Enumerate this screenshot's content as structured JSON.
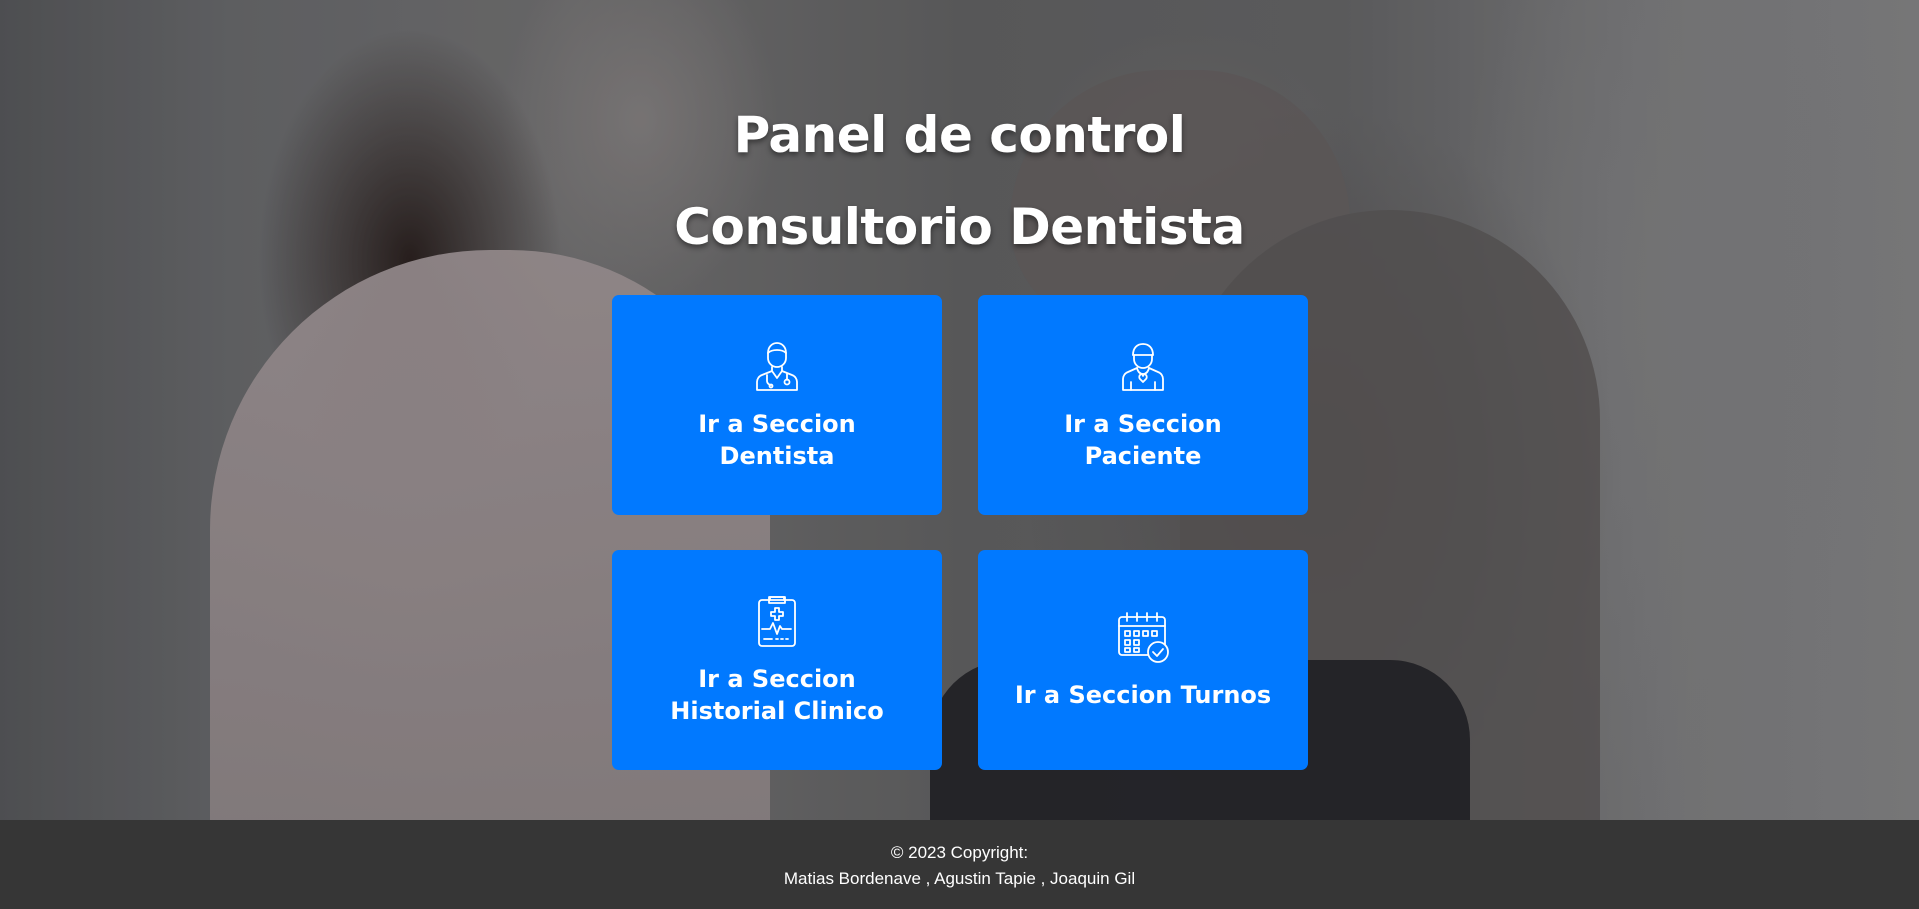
{
  "header": {
    "title_line1": "Panel de control",
    "title_line2": "Consultorio Dentista"
  },
  "cards": [
    {
      "label": "Ir a Seccion Dentista",
      "icon": "doctor-icon"
    },
    {
      "label": "Ir a Seccion Paciente",
      "icon": "patient-icon"
    },
    {
      "label": "Ir a Seccion Historial Clinico",
      "icon": "clipboard-medical-icon"
    },
    {
      "label": "Ir a Seccion Turnos",
      "icon": "calendar-check-icon"
    }
  ],
  "footer": {
    "copyright": "© 2023 Copyright:",
    "authors": "Matias Bordenave , Agustin Tapie , Joaquin Gil"
  },
  "colors": {
    "card_background": "#0179ff",
    "footer_background": "#363636",
    "text": "#ffffff"
  }
}
